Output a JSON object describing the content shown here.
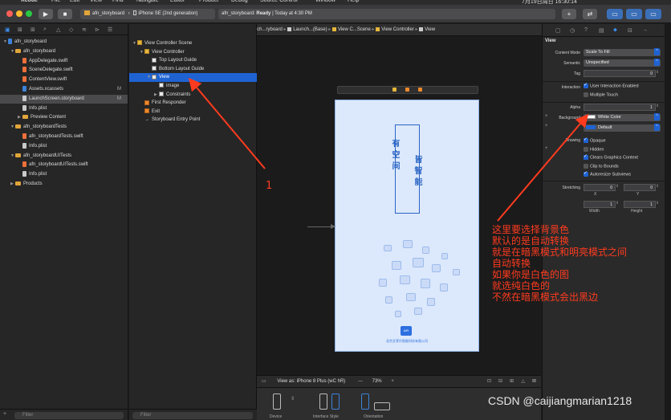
{
  "menubar": {
    "items": [
      "Xcode",
      "File",
      "Edit",
      "View",
      "Find",
      "Navigate",
      "Editor",
      "Product",
      "Debug",
      "Source Control",
      "Window",
      "Help"
    ],
    "clock": "7月19日周日 16:30:14"
  },
  "toolbar": {
    "scheme_project": "afn_storyboard",
    "scheme_device": "iPhone SE (2nd generation)",
    "status_project": "afn_storyboard:",
    "status_state": "Ready",
    "status_time": "| Today at 4:30 PM",
    "add_label": "+",
    "swap_label": "⇄"
  },
  "navigator": {
    "items": [
      {
        "label": "afn_storyboard",
        "level": 0,
        "kind": "project",
        "flag": ""
      },
      {
        "label": "afn_storyboard",
        "level": 1,
        "kind": "folder",
        "flag": ""
      },
      {
        "label": "AppDelegate.swift",
        "level": 2,
        "kind": "swift",
        "flag": ""
      },
      {
        "label": "SceneDelegate.swift",
        "level": 2,
        "kind": "swift",
        "flag": ""
      },
      {
        "label": "ContentView.swift",
        "level": 2,
        "kind": "swift",
        "flag": ""
      },
      {
        "label": "Assets.xcassets",
        "level": 2,
        "kind": "blue",
        "flag": "M"
      },
      {
        "label": "LaunchScreen.storyboard",
        "level": 2,
        "kind": "file",
        "flag": "M"
      },
      {
        "label": "Info.plist",
        "level": 2,
        "kind": "file",
        "flag": ""
      },
      {
        "label": "Preview Content",
        "level": 2,
        "kind": "folder",
        "flag": ""
      },
      {
        "label": "afn_storyboardTests",
        "level": 1,
        "kind": "folder",
        "flag": ""
      },
      {
        "label": "afn_storyboardTests.swift",
        "level": 2,
        "kind": "swift",
        "flag": ""
      },
      {
        "label": "Info.plist",
        "level": 2,
        "kind": "file",
        "flag": ""
      },
      {
        "label": "afn_storyboardUITests",
        "level": 1,
        "kind": "folder",
        "flag": ""
      },
      {
        "label": "afn_storyboardUITests.swift",
        "level": 2,
        "kind": "swift",
        "flag": ""
      },
      {
        "label": "Info.plist",
        "level": 2,
        "kind": "file",
        "flag": ""
      },
      {
        "label": "Products",
        "level": 1,
        "kind": "folder",
        "flag": ""
      }
    ],
    "selected_index": 6,
    "filter_placeholder": "Filter"
  },
  "jumpbar": {
    "crumbs": [
      "afn_storyboard",
      "afn_storyboard",
      "Launch...ryboard",
      "Launch...(Base)",
      "View C...Scene",
      "View Controller",
      "View"
    ]
  },
  "outline": {
    "items": [
      {
        "label": "View Controller Scene",
        "level": 0,
        "icon": "yellow"
      },
      {
        "label": "View Controller",
        "level": 1,
        "icon": "yellow"
      },
      {
        "label": "Top Layout Guide",
        "level": 2,
        "icon": "plain"
      },
      {
        "label": "Bottom Layout Guide",
        "level": 2,
        "icon": "plain"
      },
      {
        "label": "View",
        "level": 2,
        "icon": "plain"
      },
      {
        "label": "image",
        "level": 3,
        "icon": "plain"
      },
      {
        "label": "Constraints",
        "level": 3,
        "icon": "plain"
      },
      {
        "label": "First Responder",
        "level": 1,
        "icon": "orange"
      },
      {
        "label": "Exit",
        "level": 1,
        "icon": "orange"
      },
      {
        "label": "Storyboard Entry Point",
        "level": 1,
        "icon": "arrow"
      }
    ],
    "selected_index": 4,
    "filter_placeholder": "Filter"
  },
  "canvas": {
    "poem_left": "有空间",
    "poem_right": "皆智能",
    "logo_text": "AIR",
    "company": "北京艾菲尔智能科技有限公司",
    "footer_view_as": "View as: iPhone 8 Plus (wC hR)",
    "zoom": "73%",
    "zoom_minus": "—",
    "zoom_plus": "+",
    "device_labels": [
      "Device",
      "Interface Style",
      "Orientation"
    ]
  },
  "inspector": {
    "section_title": "View",
    "content_mode_label": "Content Mode",
    "content_mode_value": "Scale To Fill",
    "semantic_label": "Semantic",
    "semantic_value": "Unspecified",
    "tag_label": "Tag",
    "tag_value": "0",
    "interaction_label": "Interaction",
    "user_interaction": "User Interaction Enabled",
    "multiple_touch": "Multiple Touch",
    "alpha_label": "Alpha",
    "alpha_value": "1",
    "background_label": "Background",
    "background_value": "White Color",
    "tint_value": "Default",
    "drawing_label": "Drawing",
    "drawing_options": [
      {
        "label": "Opaque",
        "on": true
      },
      {
        "label": "Hidden",
        "on": false
      },
      {
        "label": "Clears Graphics Context",
        "on": true
      },
      {
        "label": "Clip to Bounds",
        "on": false
      },
      {
        "label": "Autoresize Subviews",
        "on": true
      }
    ],
    "stretching_label": "Stretching",
    "stretch_x": "0",
    "stretch_y": "0",
    "stretch_w": "1",
    "stretch_h": "1",
    "x_label": "X",
    "y_label": "Y",
    "width_label": "Width",
    "height_label": "Height",
    "colors": {
      "white": "#ffffff",
      "accent": "#1f63d3"
    }
  },
  "annotations": {
    "marker": "1",
    "lines": [
      "这里要选择背景色",
      "默认的是自动转换",
      "就是在暗黑模式和明亮模式之间",
      "自动转换",
      "如果你是白色的图",
      "就选纯白色的",
      "不然在暗黑模式会出黑边"
    ],
    "watermark": "CSDN @caijiangmarian1218"
  }
}
